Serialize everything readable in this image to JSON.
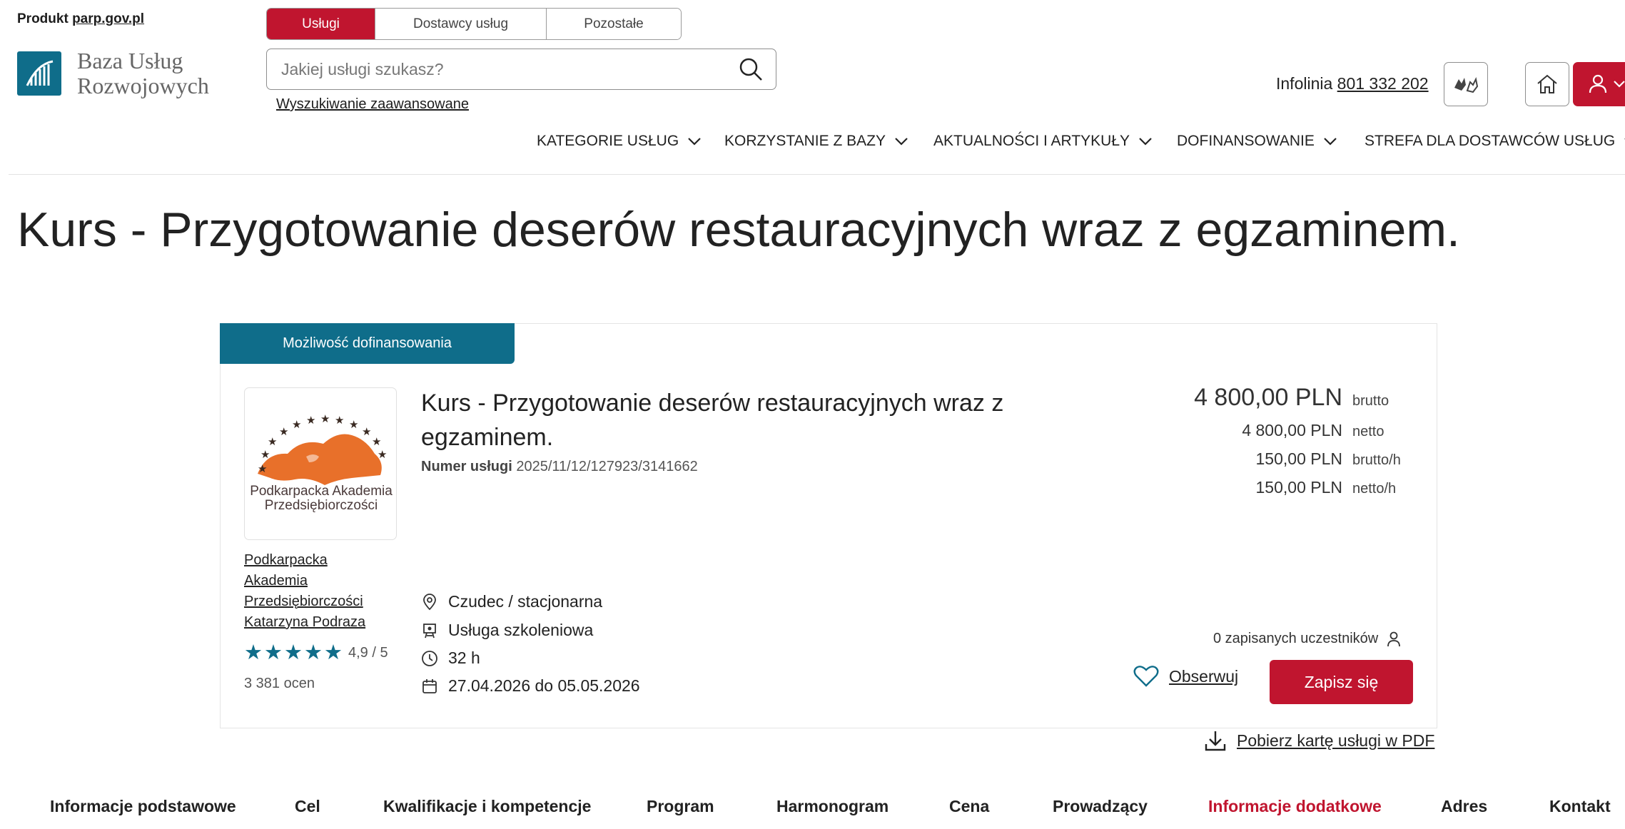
{
  "header": {
    "produkt_label": "Produkt",
    "produkt_link": "parp.gov.pl",
    "logo_line1": "Baza Usług",
    "logo_line2": "Rozwojowych",
    "segments": [
      "Usługi",
      "Dostawcy usług",
      "Pozostałe"
    ],
    "search_placeholder": "Jakiej usługi szukasz?",
    "advanced_search": "Wyszukiwanie zaawansowane",
    "infolinia_label": "Infolinia",
    "infolinia_number": "801 332 202"
  },
  "nav": [
    "KATEGORIE USŁUG",
    "KORZYSTANIE Z BAZY",
    "AKTUALNOŚCI I ARTYKUŁY",
    "DOFINANSOWANIE",
    "STREFA DLA DOSTAWCÓW USŁUG"
  ],
  "page_title": "Kurs - Przygotowanie deserów restauracyjnych wraz z egzaminem.",
  "card": {
    "tag": "Możliwość dofinansowania",
    "logo_text_1": "Podkarpacka Akademia",
    "logo_text_2": "Przedsiębiorczości",
    "provider_name": "Podkarpacka Akademia Przedsiębiorczości Katarzyna Podraza",
    "rating": "4,9 / 5",
    "rating_value": 4.9,
    "ratings_count": "3 381 ocen",
    "title": "Kurs - Przygotowanie deserów restauracyjnych wraz z egzaminem.",
    "service_number_label": "Numer usługi",
    "service_number": "2025/11/12/127923/3141662",
    "location": "Czudec / stacjonarna",
    "service_type": "Usługa szkoleniowa",
    "hours": "32 h",
    "dates": "27.04.2026 do 05.05.2026",
    "prices": [
      {
        "value": "4 800,00 PLN",
        "unit": "brutto"
      },
      {
        "value": "4 800,00 PLN",
        "unit": "netto"
      },
      {
        "value": "150,00 PLN",
        "unit": "brutto/h"
      },
      {
        "value": "150,00 PLN",
        "unit": "netto/h"
      }
    ],
    "participants": "0 zapisanych uczestników",
    "watch_label": "Obserwuj",
    "enroll_label": "Zapisz się",
    "pdf_label": "Pobierz kartę usługi w PDF"
  },
  "tabs": [
    "Informacje podstawowe",
    "Cel",
    "Kwalifikacje i kompetencje",
    "Program",
    "Harmonogram",
    "Cena",
    "Prowadzący",
    "Informacje dodatkowe",
    "Adres",
    "Kontakt"
  ],
  "active_tab": "Informacje dodatkowe",
  "colors": {
    "accent_red": "#c0152f",
    "accent_teal": "#0f6d8a",
    "logo_orange": "#e8702a"
  }
}
